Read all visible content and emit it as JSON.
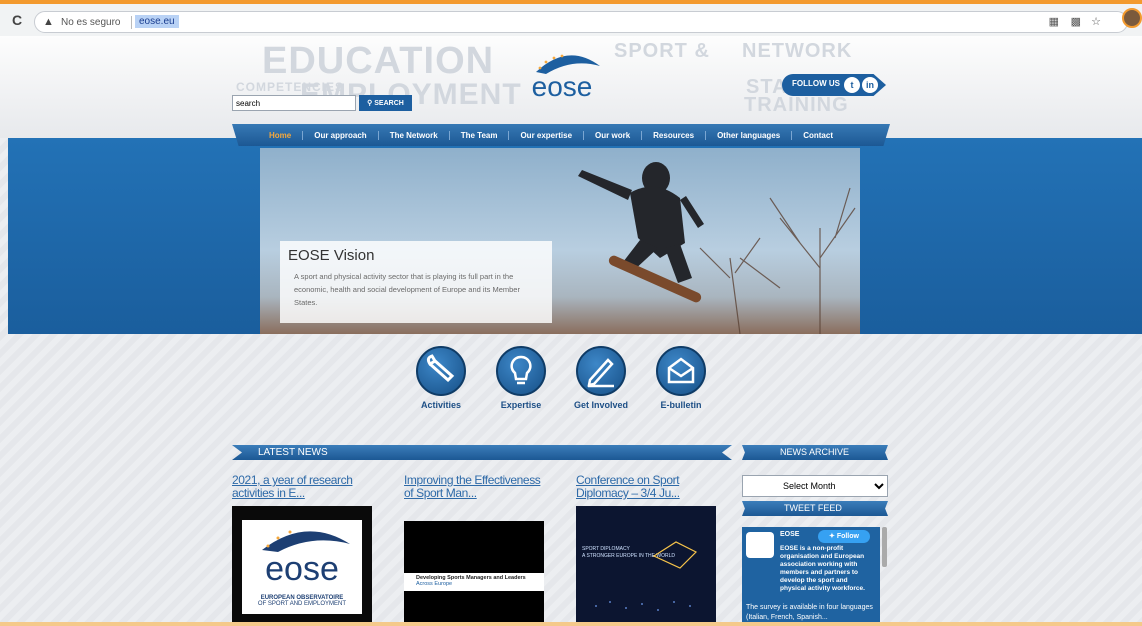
{
  "browser": {
    "security_label": "No es seguro",
    "url": "eose.eu"
  },
  "header": {
    "logo_text": "eose",
    "follow_label": "FOLLOW US",
    "background_words": [
      "EDUCATION",
      "SPORT &",
      "NETWORK",
      "EMPLOYMENT",
      "COMPETENCIES",
      "STANDARDS",
      "TRAINING"
    ],
    "search": {
      "value": "search",
      "button_label": "SEARCH"
    }
  },
  "nav": {
    "items": [
      {
        "label": "Home",
        "active": true
      },
      {
        "label": "Our approach"
      },
      {
        "label": "The Network"
      },
      {
        "label": "The Team"
      },
      {
        "label": "Our expertise"
      },
      {
        "label": "Our work"
      },
      {
        "label": "Resources"
      },
      {
        "label": "Other languages"
      },
      {
        "label": "Contact"
      }
    ]
  },
  "hero": {
    "title": "EOSE Vision",
    "text": "A sport and physical activity sector that is playing its full part in the economic, health and social development of Europe and its Member States."
  },
  "actions": [
    {
      "label": "Activities",
      "icon": "wrench-icon"
    },
    {
      "label": "Expertise",
      "icon": "lightbulb-icon"
    },
    {
      "label": "Get Involved",
      "icon": "pen-icon"
    },
    {
      "label": "E-bulletin",
      "icon": "envelope-icon"
    }
  ],
  "latest_news": {
    "heading": "LATEST NEWS",
    "items": [
      {
        "title": "2021, a year of research activities in E...",
        "image_caption_1": "EUROPEAN OBSERVATOIRE",
        "image_caption_2": "OF SPORT AND EMPLOYMENT"
      },
      {
        "title": "Improving the Effectiveness of Sport Man...",
        "image_caption_1": "Developing Sports Managers and Leaders",
        "image_caption_2": "Across Europe"
      },
      {
        "title": "Conference on Sport Diplomacy – 3/4 Ju...",
        "image_caption_1": "SPORT DIPLOMACY",
        "image_caption_2": "A STRONGER EUROPE IN THE WORLD"
      }
    ]
  },
  "news_archive": {
    "heading": "NEWS ARCHIVE",
    "select_value": "Select Month"
  },
  "tweet_feed": {
    "heading": "TWEET FEED",
    "account": "EOSE",
    "follow_label": "Follow",
    "bio": "EOSE is a non-profit organisation and European association working with members and partners to develop the sport and physical activity workforce.",
    "tweet": "The survey is available in four languages (Italian, French, Spanish..."
  },
  "colors": {
    "brand_blue": "#1d5fa0",
    "accent_orange": "#f6a83c"
  }
}
